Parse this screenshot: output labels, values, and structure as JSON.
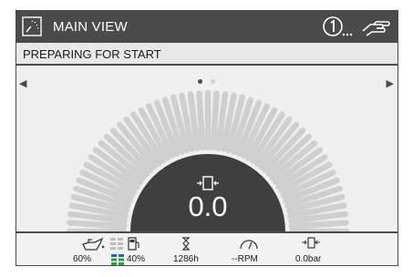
{
  "header": {
    "title": "MAIN VIEW",
    "view_icon": "gauge-view-icon",
    "alert_icon": "operator-alert-icon",
    "hand_icon": "manual-mode-hand-icon"
  },
  "status": {
    "text": "PREPARING FOR START"
  },
  "pager": {
    "active_page": 1,
    "page_count": 2,
    "prev_icon": "arrow-left-icon",
    "next_icon": "arrow-right-icon"
  },
  "gauge": {
    "value": "0.0",
    "icon": "pressure-sensor-icon",
    "fill_fraction": 0
  },
  "metrics": {
    "oil_level": "60%",
    "fuel_level": "40%",
    "runtime_hours": "1286h",
    "rpm": "--RPM",
    "pressure": "0.0bar"
  },
  "colors": {
    "title_bar": "#4b4b4b",
    "gauge_ticks": "#cfcfcf",
    "gauge_hub": "#3f3f3f",
    "fuel_green": "#2e9e3a",
    "level_blue": "#2a5fb0"
  }
}
